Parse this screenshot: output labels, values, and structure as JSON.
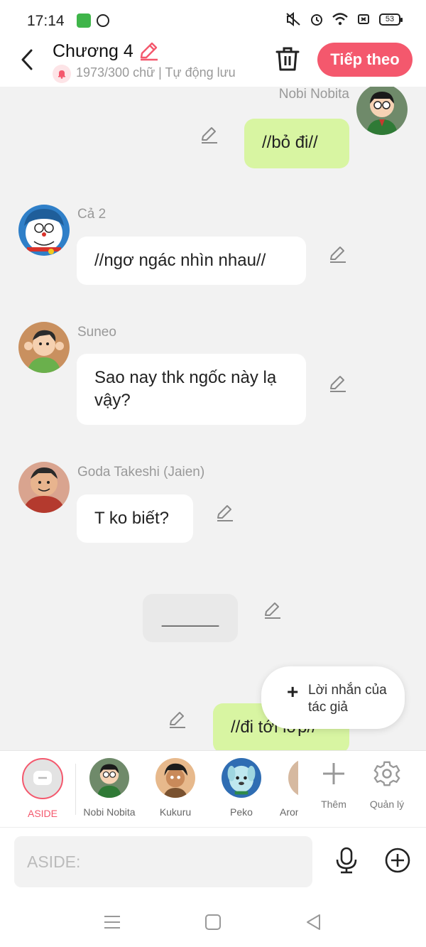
{
  "status_bar": {
    "time": "17:14",
    "battery": "53"
  },
  "header": {
    "title": "Chương 4",
    "word_count": "1973/300 chữ",
    "separator": "|",
    "autosave": "Tự động lưu",
    "next_label": "Tiếp theo"
  },
  "messages": [
    {
      "speaker": "Nobi Nobita",
      "text": "//bỏ đi//",
      "side": "right"
    },
    {
      "speaker": "Cả 2",
      "text": "//ngơ ngác nhìn nhau//",
      "side": "left"
    },
    {
      "speaker": "Suneo",
      "text": "Sao nay thk ngốc này lạ vậy?",
      "side": "left"
    },
    {
      "speaker": "Goda Takeshi (Jaien)",
      "text": "T ko biết?",
      "side": "left"
    },
    {
      "speaker": "",
      "text": "______",
      "side": "center"
    },
    {
      "speaker": "",
      "text": "//đi tới lớp//",
      "side": "right"
    }
  ],
  "author_note_popup": {
    "label": "Lời nhắn của tác giả"
  },
  "characters": [
    {
      "label": "ASIDE"
    },
    {
      "label": "Nobi Nobita"
    },
    {
      "label": "Kukuru"
    },
    {
      "label": "Peko"
    },
    {
      "label": "Aron"
    }
  ],
  "tools": {
    "add_label": "Thêm",
    "manage_label": "Quản lý"
  },
  "input": {
    "placeholder": "ASIDE:"
  },
  "colors": {
    "accent": "#f4586d",
    "own_bubble": "#d8f5a2",
    "background": "#f2f2f2"
  }
}
